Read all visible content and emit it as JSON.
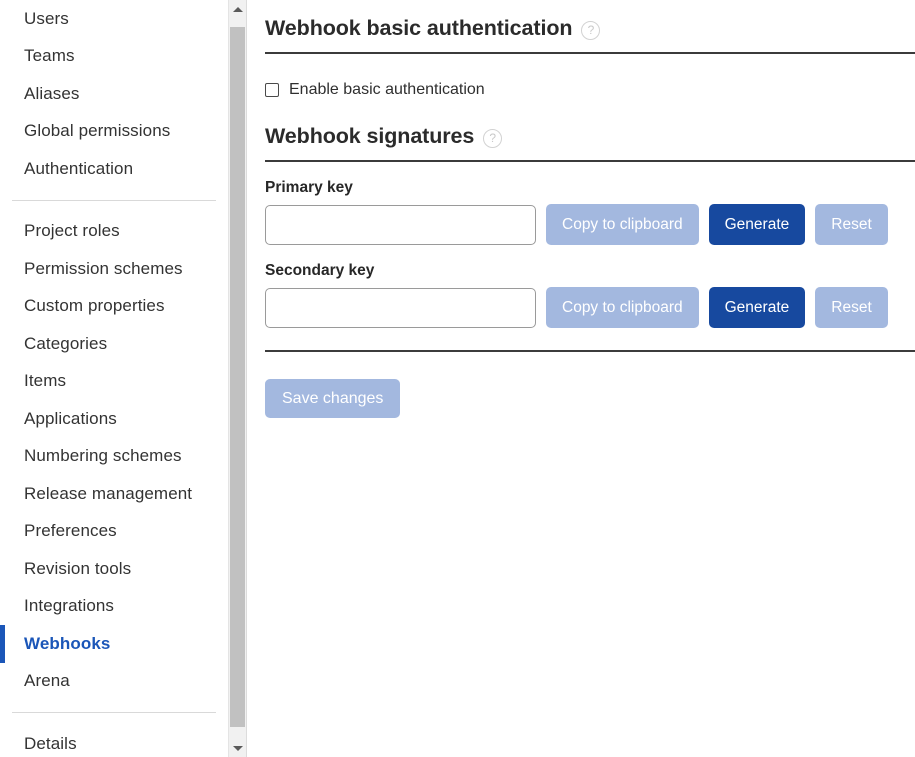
{
  "sidebar": {
    "groups": [
      {
        "items": [
          {
            "label": "Users",
            "active": false
          },
          {
            "label": "Teams",
            "active": false
          },
          {
            "label": "Aliases",
            "active": false
          },
          {
            "label": "Global permissions",
            "active": false
          },
          {
            "label": "Authentication",
            "active": false
          }
        ]
      },
      {
        "items": [
          {
            "label": "Project roles",
            "active": false
          },
          {
            "label": "Permission schemes",
            "active": false
          },
          {
            "label": "Custom properties",
            "active": false
          },
          {
            "label": "Categories",
            "active": false
          },
          {
            "label": "Items",
            "active": false
          },
          {
            "label": "Applications",
            "active": false
          },
          {
            "label": "Numbering schemes",
            "active": false
          },
          {
            "label": "Release management",
            "active": false
          },
          {
            "label": "Preferences",
            "active": false
          },
          {
            "label": "Revision tools",
            "active": false
          },
          {
            "label": "Integrations",
            "active": false
          },
          {
            "label": "Webhooks",
            "active": true
          },
          {
            "label": "Arena",
            "active": false
          }
        ]
      },
      {
        "items": [
          {
            "label": "Details",
            "active": false
          }
        ]
      }
    ],
    "scrollbar": {
      "up_arrow": "scroll-up-arrow",
      "down_arrow": "scroll-down-arrow"
    },
    "active_accent_color": "#1b56b8"
  },
  "main": {
    "basic_auth": {
      "title": "Webhook basic authentication",
      "help_glyph": "?",
      "checkbox_label": "Enable basic authentication",
      "checkbox_checked": false
    },
    "signatures": {
      "title": "Webhook signatures",
      "help_glyph": "?",
      "primary": {
        "label": "Primary key",
        "value": "",
        "placeholder": "",
        "copy_label": "Copy to clipboard",
        "generate_label": "Generate",
        "reset_label": "Reset"
      },
      "secondary": {
        "label": "Secondary key",
        "value": "",
        "placeholder": "",
        "copy_label": "Copy to clipboard",
        "generate_label": "Generate",
        "reset_label": "Reset"
      }
    },
    "save_label": "Save changes",
    "colors": {
      "primary_button": "#17499f",
      "muted_button": "#a3b8df",
      "rule": "#3c3c3c"
    }
  }
}
